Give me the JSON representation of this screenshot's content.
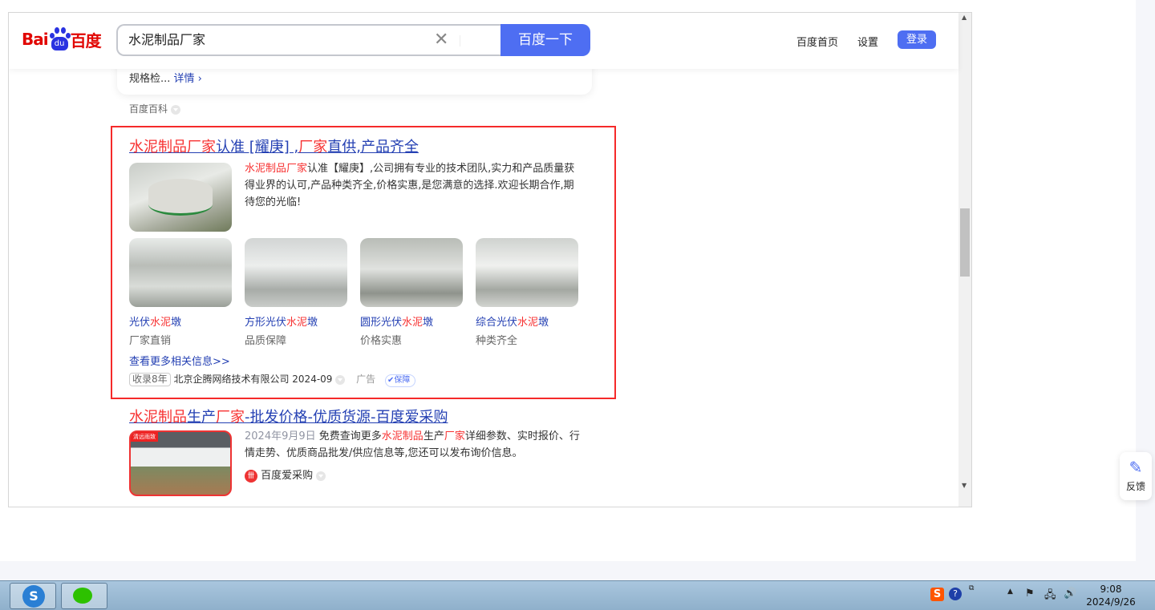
{
  "header": {
    "logo": {
      "bai": "Bai",
      "du": "du",
      "cn": "百度"
    },
    "query": "水泥制品厂家",
    "search_button": "百度一下",
    "nav": [
      "百度首页",
      "设置"
    ],
    "login": "登录"
  },
  "prev_card": {
    "snippet": "规格检...",
    "detail": "详情 ›",
    "source": "百度百科"
  },
  "ad": {
    "title": [
      {
        "t": "水泥制品厂家",
        "hl": true
      },
      {
        "t": "认准 [耀庚] ,",
        "hl": false
      },
      {
        "t": "厂家",
        "hl": true
      },
      {
        "t": "直供,产品齐全",
        "hl": false
      }
    ],
    "desc": [
      {
        "t": "水泥制品厂家",
        "hl": true
      },
      {
        "t": "认准【耀庚】,公司拥有专业的技术团队,实力和产品质量获得业界的认可,产品种类齐全,价格实惠,是您满意的选择.欢迎长期合作,期待您的光临!",
        "hl": false
      }
    ],
    "products": [
      {
        "name": [
          {
            "t": "光伏",
            "hl": false
          },
          {
            "t": "水泥",
            "hl": true
          },
          {
            "t": "墩",
            "hl": false
          }
        ],
        "sub": "厂家直销"
      },
      {
        "name": [
          {
            "t": "方形光伏",
            "hl": false
          },
          {
            "t": "水泥",
            "hl": true
          },
          {
            "t": "墩",
            "hl": false
          }
        ],
        "sub": "品质保障"
      },
      {
        "name": [
          {
            "t": "圆形光伏",
            "hl": false
          },
          {
            "t": "水泥",
            "hl": true
          },
          {
            "t": "墩",
            "hl": false
          }
        ],
        "sub": "价格实惠"
      },
      {
        "name": [
          {
            "t": "综合光伏",
            "hl": false
          },
          {
            "t": "水泥",
            "hl": true
          },
          {
            "t": "墩",
            "hl": false
          }
        ],
        "sub": "种类齐全"
      }
    ],
    "more": "查看更多相关信息>>",
    "record": "收录8年",
    "company": "北京企腾网络技术有限公司 2024-09",
    "ad_label": "广告",
    "guarantee": "保障"
  },
  "result2": {
    "title": [
      {
        "t": "水泥制品",
        "hl": true
      },
      {
        "t": "生产",
        "hl": false
      },
      {
        "t": "厂家",
        "hl": true
      },
      {
        "t": "-批发价格-优质货源-百度爱采购",
        "hl": false
      }
    ],
    "date": "2024年9月9日",
    "desc": [
      {
        "t": "免费查询更多",
        "hl": false
      },
      {
        "t": "水泥制品",
        "hl": true
      },
      {
        "t": "生产",
        "hl": false
      },
      {
        "t": "厂家",
        "hl": true
      },
      {
        "t": "详细参数、实时报价、行情走势、优质商品批发/供应信息等,您还可以发布询价信息。",
        "hl": false
      }
    ],
    "source": "百度爱采购"
  },
  "feedback": "反馈",
  "taskbar": {
    "time": "9:08",
    "date": "2024/9/26"
  }
}
